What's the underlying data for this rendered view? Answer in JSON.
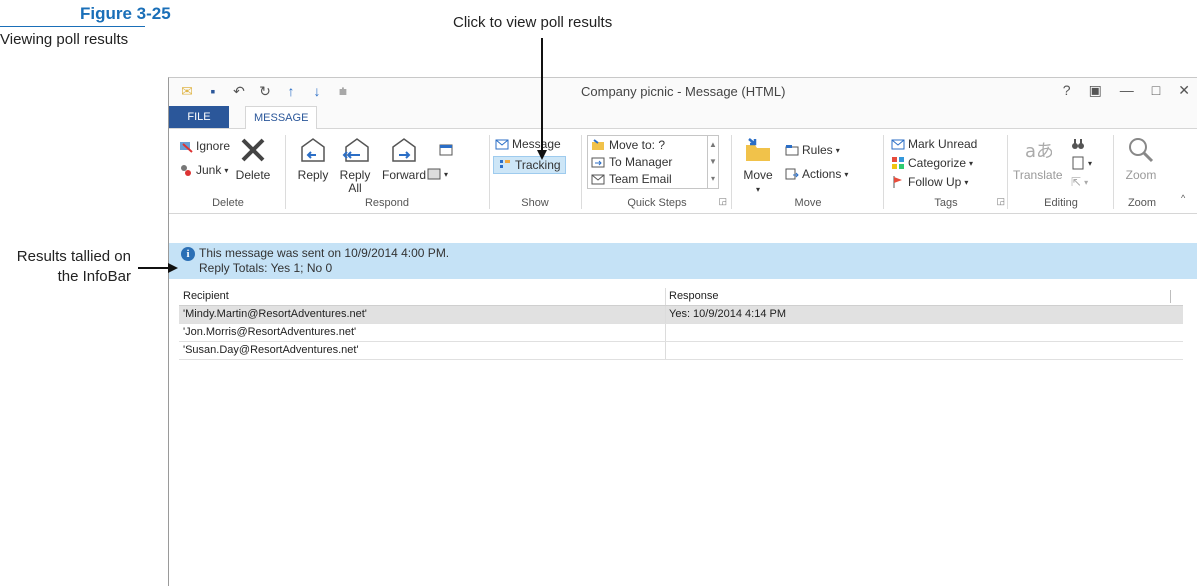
{
  "figure": {
    "number": "Figure 3-25",
    "caption": "Viewing poll results"
  },
  "callouts": {
    "top": "Click to view poll results",
    "left": "Results tallied on the InfoBar"
  },
  "window": {
    "title": "Company picnic - Message (HTML)",
    "controls": [
      "?",
      "▣",
      "—",
      "□",
      "✕"
    ]
  },
  "tabs": {
    "file": "FILE",
    "message": "MESSAGE"
  },
  "ribbon": {
    "delete_group": {
      "label": "Delete",
      "ignore": "Ignore",
      "junk": "Junk",
      "delete": "Delete"
    },
    "respond_group": {
      "label": "Respond",
      "reply": "Reply",
      "reply_all_line1": "Reply",
      "reply_all_line2": "All",
      "forward": "Forward"
    },
    "show_group": {
      "label": "Show",
      "message": "Message",
      "tracking": "Tracking"
    },
    "quick_steps_group": {
      "label": "Quick Steps",
      "items": [
        "Move to: ?",
        "To Manager",
        "Team Email"
      ]
    },
    "move_group": {
      "label": "Move",
      "move": "Move",
      "rules": "Rules",
      "actions": "Actions"
    },
    "tags_group": {
      "label": "Tags",
      "mark_unread": "Mark Unread",
      "categorize": "Categorize",
      "follow_up": "Follow Up"
    },
    "editing_group": {
      "label": "Editing",
      "translate": "Translate"
    },
    "zoom_group": {
      "label": "Zoom",
      "zoom": "Zoom"
    }
  },
  "infobar": {
    "line1": "This message was sent on 10/9/2014 4:00 PM.",
    "line2": "Reply Totals: Yes 1; No 0"
  },
  "tracking_table": {
    "headers": {
      "recipient": "Recipient",
      "response": "Response"
    },
    "rows": [
      {
        "recipient": "'Mindy.Martin@ResortAdventures.net'",
        "response": "Yes: 10/9/2014 4:14 PM"
      },
      {
        "recipient": "'Jon.Morris@ResortAdventures.net'",
        "response": ""
      },
      {
        "recipient": "'Susan.Day@ResortAdventures.net'",
        "response": ""
      }
    ]
  }
}
